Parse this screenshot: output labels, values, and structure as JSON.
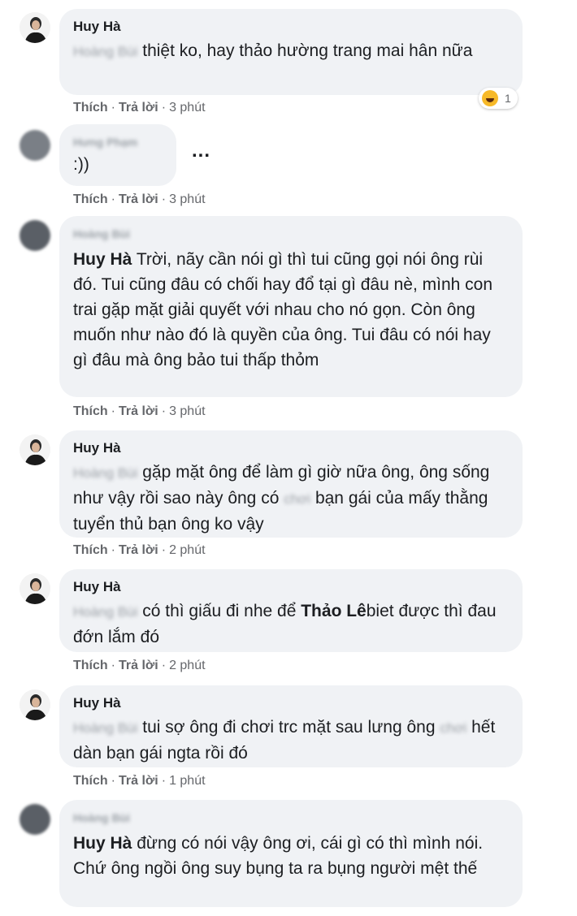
{
  "comments": [
    {
      "name": "Huy Hà",
      "mention": "Hoàng Bùi",
      "text": "thiệt ko, hay thảo hường trang mai hân nữa",
      "like": "Thích",
      "reply": "Trả lời",
      "time": "3 phút",
      "reaction_count": "1"
    },
    {
      "name": "Hưng Phạm",
      "text": ":))",
      "like": "Thích",
      "reply": "Trả lời",
      "time": "3 phút",
      "more": "..."
    },
    {
      "name": "Hoàng Bùi",
      "mention": "Huy Hà",
      "text": "Trời, nãy cần nói gì thì tui cũng gọi nói ông rùi đó. Tui cũng đâu có chối hay đổ tại gì đâu nè, mình con trai gặp mặt giải quyết với nhau cho nó gọn. Còn ông muốn như nào đó là quyền của ông. Tui đâu có nói hay gì đâu mà ông bảo tui thấp thỏm",
      "like": "Thích",
      "reply": "Trả lời",
      "time": "3 phút"
    },
    {
      "name": "Huy Hà",
      "mention": "Hoàng Bùi",
      "text1": "gặp mặt ông để làm gì giờ nữa ông, ông sống như vậy rồi sao này ông có",
      "hidden_word": "chơi",
      "text2": "bạn gái của mấy thằng tuyển thủ bạn ông ko vậy",
      "like": "Thích",
      "reply": "Trả lời",
      "time": "2 phút"
    },
    {
      "name": "Huy Hà",
      "mention": "Hoàng Bùi",
      "text1": "có thì giấu đi nhe để",
      "mention2": "Thảo Lê",
      "text2": "biet được thì đau đớn lắm đó",
      "like": "Thích",
      "reply": "Trả lời",
      "time": "2 phút"
    },
    {
      "name": "Huy Hà",
      "mention": "Hoàng Bùi",
      "text1": "tui sợ ông đi chơi trc mặt sau lưng ông",
      "hidden_word": "chơi",
      "text2": "hết dàn bạn gái ngta rồi đó",
      "like": "Thích",
      "reply": "Trả lời",
      "time": "1 phút"
    },
    {
      "name": "Hoàng Bùi",
      "mention": "Huy Hà",
      "text": "đừng có nói vậy ông ơi, cái gì có thì mình nói. Chứ ông ngồi ông suy bụng ta ra bụng người mệt thế"
    }
  ],
  "separator": "·"
}
